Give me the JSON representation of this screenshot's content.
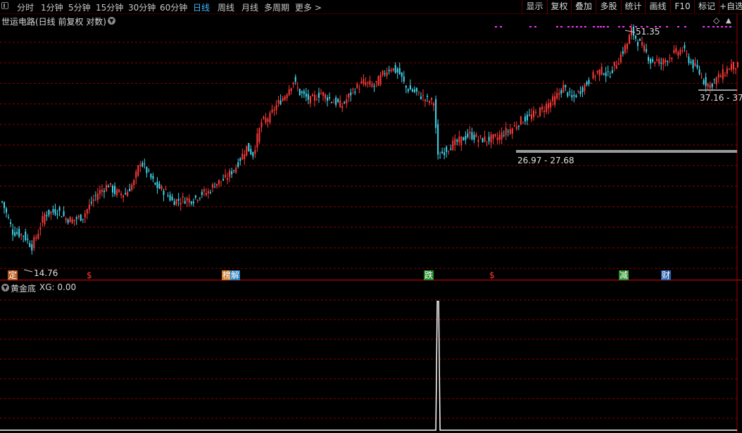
{
  "toolbar": {
    "periods": [
      "分时",
      "1分钟",
      "5分钟",
      "15分钟",
      "30分钟",
      "60分钟",
      "日线",
      "周线",
      "月线",
      "多周期",
      "更多 >"
    ],
    "active_period": "日线",
    "tools": [
      "显示",
      "复权",
      "叠加",
      "多股",
      "统计",
      "画线",
      "F10",
      "标记",
      "+自选"
    ]
  },
  "main_panel": {
    "stock_title": "世运电路(日线 前复权 对数)",
    "labels": {
      "high": "51.35",
      "low": "14.76",
      "band1": "26.97 - 27.68",
      "band2": "37.16 - 37"
    },
    "event_tags": [
      {
        "text": "定",
        "color": "#ffffff",
        "bg": "#b85a1e"
      },
      {
        "text": "$",
        "color": "#ff3a3a",
        "bg": ""
      },
      {
        "text": "榜",
        "color": "#ffffff",
        "bg": "#c8782a"
      },
      {
        "text": "解",
        "color": "#ffffff",
        "bg": "#2a80c0"
      },
      {
        "text": "跌",
        "color": "#ffffff",
        "bg": "#1f8a2a"
      },
      {
        "text": "$",
        "color": "#ff3a3a",
        "bg": ""
      },
      {
        "text": "减",
        "color": "#ffffff",
        "bg": "#2f8f2f"
      },
      {
        "text": "财",
        "color": "#ffffff",
        "bg": "#2a5fa8"
      }
    ],
    "colors": {
      "up": "#ff3a3a",
      "down": "#3fd8ef",
      "grid": "#8b0000",
      "panel_border": "#a00000",
      "marker": "#ff33ff",
      "band": "#9a9a9a"
    }
  },
  "indicator_panel": {
    "title": "黄金底",
    "xg_label": "XG: 0.00"
  },
  "chart_data": {
    "type": "candlestick",
    "scale": "log",
    "title": "世运电路(日线 前复权 对数)",
    "ylim": [
      13.5,
      56
    ],
    "price_anchors": [
      [
        0,
        19.5
      ],
      [
        5,
        16.5
      ],
      [
        10,
        16.2
      ],
      [
        14,
        15.2
      ],
      [
        17,
        16.5
      ],
      [
        20,
        18.2
      ],
      [
        26,
        18.6
      ],
      [
        30,
        17.8
      ],
      [
        33,
        17.6
      ],
      [
        38,
        18.0
      ],
      [
        40,
        18.7
      ],
      [
        45,
        20.5
      ],
      [
        50,
        21.5
      ],
      [
        53,
        20.6
      ],
      [
        58,
        20.4
      ],
      [
        62,
        21.8
      ],
      [
        65,
        24.5
      ],
      [
        68,
        23.2
      ],
      [
        72,
        21.4
      ],
      [
        77,
        20.6
      ],
      [
        80,
        19.6
      ],
      [
        85,
        19.8
      ],
      [
        90,
        19.8
      ],
      [
        94,
        20.5
      ],
      [
        97,
        20.6
      ],
      [
        100,
        21.6
      ],
      [
        105,
        22.2
      ],
      [
        110,
        23.8
      ],
      [
        115,
        26.5
      ],
      [
        118,
        25.5
      ],
      [
        122,
        30.5
      ],
      [
        126,
        31.5
      ],
      [
        128,
        33.0
      ],
      [
        133,
        35.5
      ],
      [
        137,
        38.5
      ],
      [
        140,
        36.0
      ],
      [
        145,
        34.5
      ],
      [
        150,
        36.0
      ],
      [
        155,
        34.5
      ],
      [
        160,
        33.5
      ],
      [
        165,
        36.5
      ],
      [
        170,
        38.2
      ],
      [
        175,
        37.4
      ],
      [
        180,
        40.5
      ],
      [
        183,
        41.5
      ],
      [
        187,
        40.0
      ],
      [
        190,
        37.0
      ],
      [
        195,
        36.0
      ],
      [
        200,
        34.5
      ],
      [
        203,
        34.2
      ],
      [
        205,
        25.0
      ],
      [
        208,
        26.0
      ],
      [
        212,
        27.0
      ],
      [
        215,
        27.5
      ],
      [
        220,
        28.5
      ],
      [
        224,
        27.8
      ],
      [
        228,
        27.7
      ],
      [
        233,
        28.0
      ],
      [
        236,
        28.8
      ],
      [
        240,
        29.5
      ],
      [
        244,
        30.8
      ],
      [
        247,
        31.3
      ],
      [
        252,
        32.2
      ],
      [
        256,
        33.5
      ],
      [
        260,
        34.8
      ],
      [
        264,
        37.2
      ],
      [
        268,
        34.8
      ],
      [
        272,
        36.5
      ],
      [
        276,
        38.5
      ],
      [
        280,
        40.5
      ],
      [
        283,
        40.8
      ],
      [
        285,
        39.5
      ],
      [
        290,
        43.5
      ],
      [
        294,
        47.5
      ],
      [
        296,
        51.0
      ],
      [
        299,
        48.0
      ],
      [
        302,
        46.0
      ],
      [
        305,
        43.0
      ],
      [
        308,
        43.2
      ],
      [
        310,
        42.5
      ],
      [
        315,
        44.6
      ],
      [
        320,
        46.0
      ],
      [
        324,
        42.5
      ],
      [
        327,
        41.0
      ],
      [
        330,
        38.5
      ],
      [
        333,
        37.5
      ],
      [
        336,
        39.0
      ],
      [
        340,
        40.5
      ],
      [
        343,
        42.0
      ],
      [
        346,
        41.8
      ]
    ],
    "high_label": 51.35,
    "low_label": 14.76,
    "support_bands": [
      [
        26.97,
        27.68
      ],
      [
        37.16,
        37
      ]
    ],
    "indicator": {
      "name": "黄金底",
      "series": "XG",
      "last_value": 0.0,
      "spikes_at_bar": [
        205
      ]
    }
  }
}
